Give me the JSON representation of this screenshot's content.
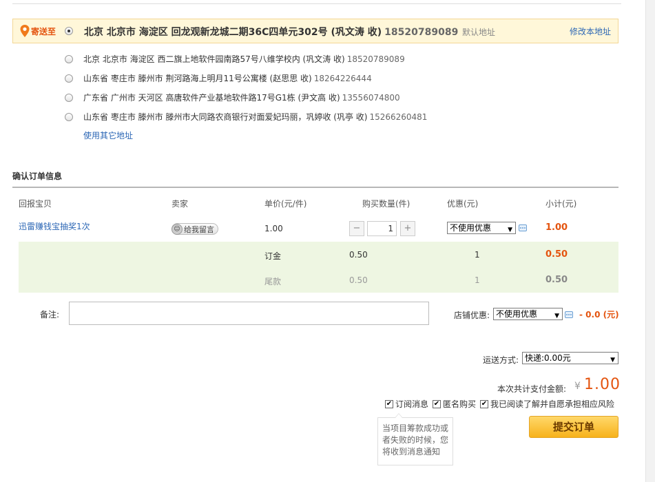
{
  "address": {
    "ship_to_label": "寄送至",
    "selected": {
      "text": "北京 北京市 海淀区 回龙观新龙城二期36C四单元302号 (巩文涛 收)",
      "phone": "18520789089",
      "default_tag": "默认地址",
      "modify_label": "修改本地址"
    },
    "others": [
      {
        "text": "北京 北京市 海淀区 西二旗上地软件园南路57号八维学校内 (巩文涛 收)",
        "phone": "18520789089"
      },
      {
        "text": "山东省 枣庄市 滕州市 荆河路海上明月11号公寓楼 (赵思思 收)",
        "phone": "18264226444"
      },
      {
        "text": "广东省 广州市 天河区 高唐软件产业基地软件路17号G1栋 (尹文高 收)",
        "phone": "13556074800"
      },
      {
        "text": "山东省 枣庄市 滕州市 滕州市大同路农商银行对面爱妃玛丽，巩婷收 (巩亭 收)",
        "phone": "15266260481"
      }
    ],
    "use_other_label": "使用其它地址"
  },
  "order": {
    "section_title": "确认订单信息",
    "columns": [
      "回报宝贝",
      "卖家",
      "单价(元/件)",
      "购买数量(件)",
      "优惠(元)",
      "小计(元)"
    ],
    "item": {
      "name": "迅雷赚钱宝抽奖1次",
      "message_button": "给我留言",
      "unit_price": "1.00",
      "quantity": "1",
      "coupon_selected": "不使用优惠",
      "subtotal": "1.00"
    },
    "deposit": {
      "label": "订金",
      "price": "0.50",
      "qty": "1",
      "subtotal": "0.50"
    },
    "balance": {
      "label": "尾款",
      "price": "0.50",
      "qty": "1",
      "subtotal": "0.50"
    }
  },
  "remark": {
    "label": "备注:",
    "value": ""
  },
  "shop_discount": {
    "label": "店铺优惠:",
    "selected": "不使用优惠",
    "amount": "- 0.0 (元)"
  },
  "shipping": {
    "label": "运送方式:",
    "selected": "快递:0.00元"
  },
  "total": {
    "label": "本次共计支付金额:",
    "currency": "¥",
    "amount": "1.00"
  },
  "options": [
    {
      "label": "订阅消息",
      "checked": true
    },
    {
      "label": "匿名购买",
      "checked": true
    },
    {
      "label": "我已阅读了解并自愿承担相应风险",
      "checked": true
    }
  ],
  "tooltip": "当项目筹款成功或者失败的时候，您将收到消息通知",
  "submit_label": "提交订单",
  "colors": {
    "accent": "#e4540f",
    "link": "#2c67b5",
    "highlight_bg": "#fff7d9",
    "green_bg": "#eef6e2"
  }
}
